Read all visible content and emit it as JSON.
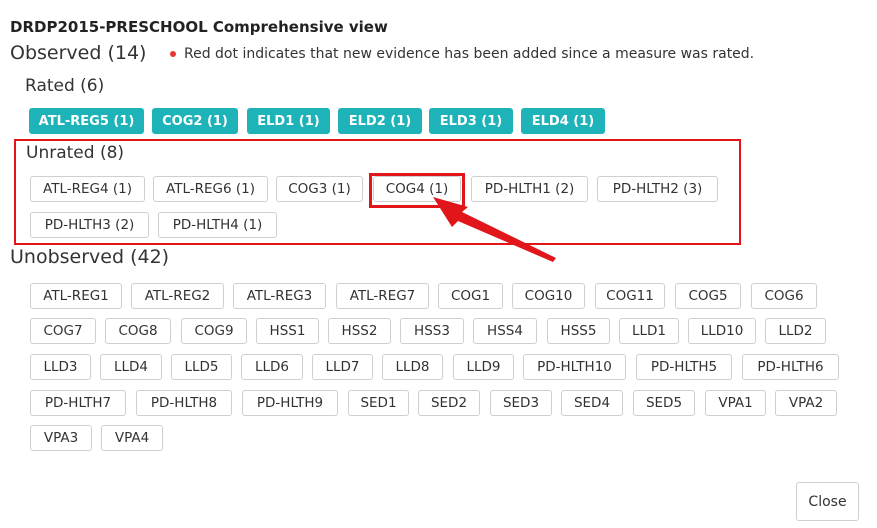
{
  "title": "DRDP2015-PRESCHOOL Comprehensive view",
  "observed_heading": "Observed (14)",
  "legend_note": "Red dot indicates that new evidence has been added since a measure was rated.",
  "rated_heading": "Rated (6)",
  "unrated_heading": "Unrated (8)",
  "unobserved_heading": "Unobserved (42)",
  "rated": [
    "ATL-REG5 (1)",
    "COG2 (1)",
    "ELD1 (1)",
    "ELD2 (1)",
    "ELD3 (1)",
    "ELD4 (1)"
  ],
  "unrated": [
    "ATL-REG4 (1)",
    "ATL-REG6 (1)",
    "COG3 (1)",
    "COG4 (1)",
    "PD-HLTH1 (2)",
    "PD-HLTH2 (3)",
    "PD-HLTH3 (2)",
    "PD-HLTH4 (1)"
  ],
  "unobserved": [
    "ATL-REG1",
    "ATL-REG2",
    "ATL-REG3",
    "ATL-REG7",
    "COG1",
    "COG10",
    "COG11",
    "COG5",
    "COG6",
    "COG7",
    "COG8",
    "COG9",
    "HSS1",
    "HSS2",
    "HSS3",
    "HSS4",
    "HSS5",
    "LLD1",
    "LLD10",
    "LLD2",
    "LLD3",
    "LLD4",
    "LLD5",
    "LLD6",
    "LLD7",
    "LLD8",
    "LLD9",
    "PD-HLTH10",
    "PD-HLTH5",
    "PD-HLTH6",
    "PD-HLTH7",
    "PD-HLTH8",
    "PD-HLTH9",
    "SED1",
    "SED2",
    "SED3",
    "SED4",
    "SED5",
    "VPA1",
    "VPA2",
    "VPA3",
    "VPA4"
  ],
  "close_label": "Close",
  "colors": {
    "teal": "#1db3b8",
    "annotation_red": "#e0161b",
    "dot_red": "#e53935"
  }
}
